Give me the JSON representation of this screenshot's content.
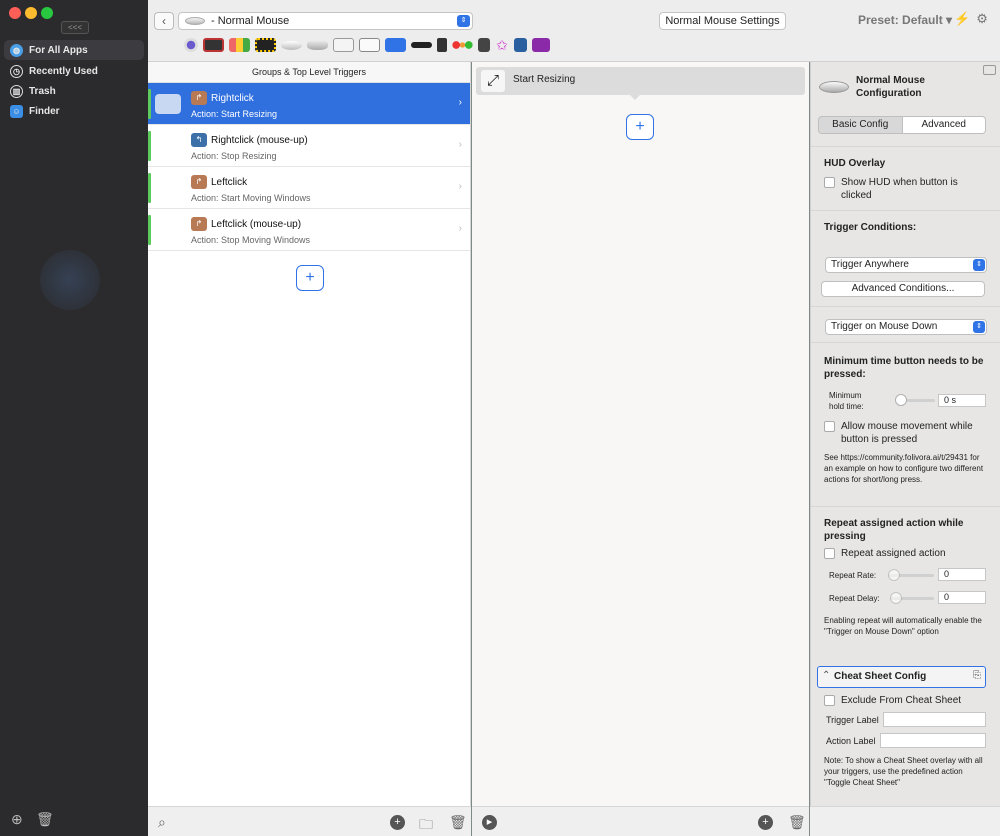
{
  "sidebar": {
    "collapse_label": "<<<",
    "items": [
      {
        "label": "For All Apps",
        "icon": "globe-icon",
        "selected": true
      },
      {
        "label": "Recently Used",
        "icon": "clock-icon",
        "selected": false
      },
      {
        "label": "Trash",
        "icon": "trash-icon",
        "selected": false
      },
      {
        "label": "Finder",
        "icon": "finder-icon",
        "selected": false
      }
    ]
  },
  "toolbar": {
    "device_select": "- Normal Mouse",
    "settings_button": "Normal Mouse Settings",
    "preset": "Preset: Default",
    "device_icons": [
      "trackpad",
      "touchbar",
      "stream-deck",
      "keyboard-grid",
      "magic-mouse",
      "mouse-gray",
      "keyboard",
      "drawing-tablet",
      "normal-mouse",
      "remote",
      "siri-remote",
      "traffic-lights",
      "grid",
      "star",
      "network",
      "display"
    ]
  },
  "triggers": {
    "header": "Groups & Top Level Triggers",
    "rows": [
      {
        "name": "Rightclick",
        "action": "Action: Start Resizing",
        "selected": true
      },
      {
        "name": "Rightclick (mouse-up)",
        "action": "Action: Stop Resizing",
        "selected": false
      },
      {
        "name": "Leftclick",
        "action": "Action: Start Moving Windows",
        "selected": false
      },
      {
        "name": "Leftclick (mouse-up)",
        "action": "Action: Stop Moving Windows",
        "selected": false
      }
    ]
  },
  "actions": {
    "items": [
      {
        "label": "Start Resizing"
      }
    ]
  },
  "config": {
    "title": "Normal Mouse Configuration",
    "tabs": {
      "basic": "Basic Config",
      "advanced": "Advanced"
    },
    "hud": {
      "heading": "HUD Overlay",
      "checkbox": "Show HUD when button is clicked"
    },
    "conditions": {
      "heading": "Trigger Conditions:",
      "where": "Trigger Anywhere",
      "advanced_button": "Advanced Conditions...",
      "when": "Trigger on Mouse Down"
    },
    "min_time": {
      "heading": "Minimum time button needs to be pressed:",
      "hold_label": "Minimum hold time:",
      "hold_value": "0 s",
      "movement_checkbox": "Allow mouse movement while button is pressed",
      "note": "See https://community.folivora.ai/t/29431 for an example on how to configure two different actions for short/long press."
    },
    "repeat": {
      "heading": "Repeat assigned action while pressing",
      "checkbox": "Repeat assigned action",
      "rate_label": "Repeat Rate:",
      "rate_value": "0",
      "delay_label": "Repeat Delay:",
      "delay_value": "0",
      "note": "Enabling repeat will automatically enable the \"Trigger on Mouse Down\" option"
    },
    "cheat_sheet": {
      "heading": "Cheat Sheet Config",
      "exclude": "Exclude From Cheat Sheet",
      "trigger_label": "Trigger Label",
      "action_label": "Action Label",
      "note": "Note: To show a Cheat Sheet overlay with all your triggers, use the predefined action \"Toggle Cheat Sheet\""
    }
  }
}
